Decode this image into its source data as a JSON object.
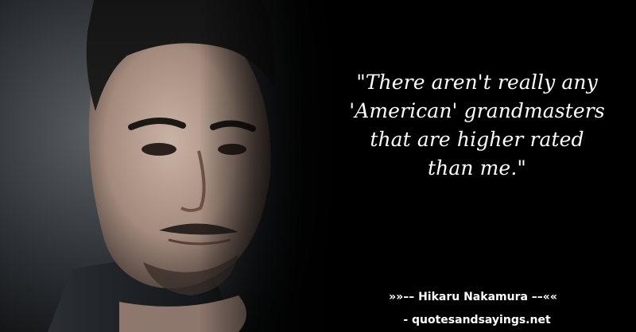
{
  "quote": {
    "lines": [
      "\"There aren't really any",
      "'American' grandmasters",
      "that are higher rated",
      "than me.\""
    ]
  },
  "attribution": {
    "author_line": "»»–– Hikaru Nakamura ––««",
    "source": "- quotesandsayings.net"
  },
  "colors": {
    "background": "#000000",
    "text": "#ffffff"
  }
}
